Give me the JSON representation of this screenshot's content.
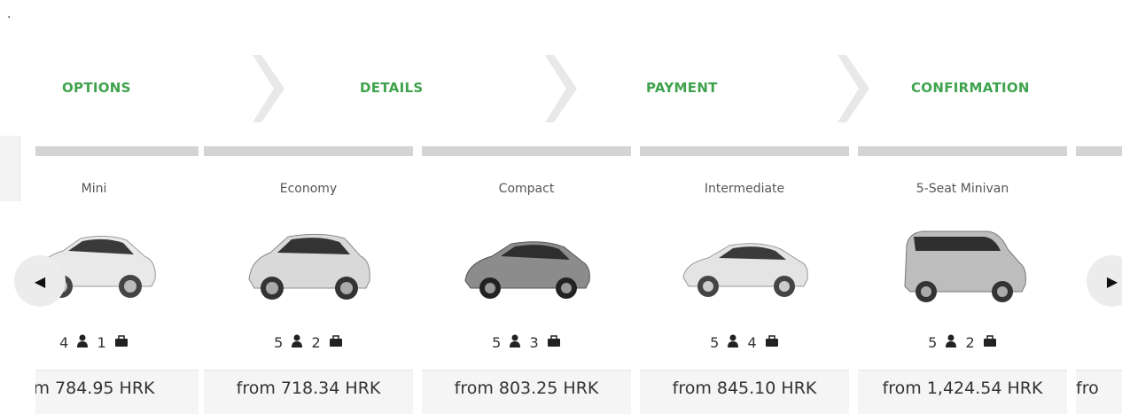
{
  "page": {
    "dot": "."
  },
  "steps": [
    {
      "label": "OPTIONS"
    },
    {
      "label": "DETAILS"
    },
    {
      "label": "PAYMENT"
    },
    {
      "label": "CONFIRMATION"
    }
  ],
  "colors": {
    "step_text": "#3fa34d",
    "card_top": "#d4d4d4",
    "price_bg": "#f5f5f5"
  },
  "icons": {
    "person": "person-icon",
    "bag": "briefcase-icon",
    "prev": "chevron-left-icon",
    "next": "chevron-right-icon"
  },
  "cars": [
    {
      "category": "Mini",
      "seats": "4",
      "bags": "1",
      "price": "m 784.95 HRK"
    },
    {
      "category": "Economy",
      "seats": "5",
      "bags": "2",
      "price": "from 718.34 HRK"
    },
    {
      "category": "Compact",
      "seats": "5",
      "bags": "3",
      "price": "from 803.25 HRK"
    },
    {
      "category": "Intermediate",
      "seats": "5",
      "bags": "4",
      "price": "from 845.10 HRK"
    },
    {
      "category": "5-Seat Minivan",
      "seats": "5",
      "bags": "2",
      "price": "from 1,424.54 HRK"
    },
    {
      "category": "",
      "seats": "",
      "bags": "",
      "price": "fro"
    }
  ],
  "arrows": {
    "prev": "◀",
    "next": "▶"
  }
}
